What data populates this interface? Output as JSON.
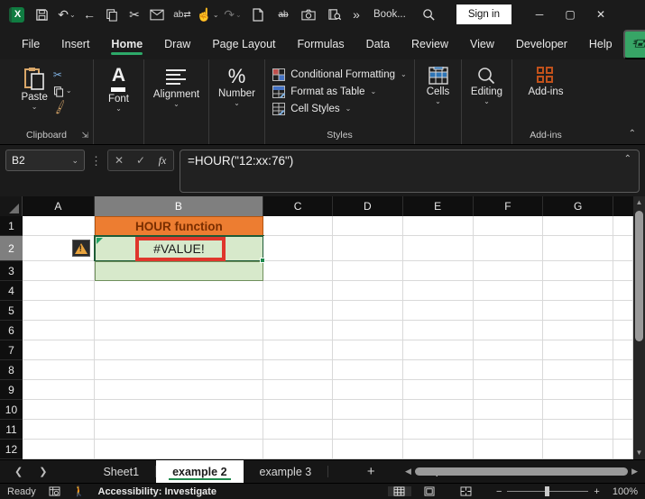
{
  "titlebar": {
    "workbook_name": "Book...",
    "sign_in_label": "Sign in",
    "quick_access_icons": [
      "excel-logo",
      "save",
      "undo",
      "back",
      "copy",
      "cut",
      "email",
      "find-replace",
      "touch-mode",
      "redo",
      "new-file",
      "draw",
      "camera",
      "lookup",
      "more-commands"
    ]
  },
  "menubar": {
    "items": [
      "File",
      "Insert",
      "Home",
      "Draw",
      "Page Layout",
      "Formulas",
      "Data",
      "Review",
      "View",
      "Developer",
      "Help"
    ],
    "active_item": "Home",
    "share_label": "Share"
  },
  "ribbon": {
    "paste_label": "Paste",
    "clipboard_group_label": "Clipboard",
    "font_label": "Font",
    "alignment_label": "Alignment",
    "number_label": "Number",
    "styles_items": [
      "Conditional Formatting",
      "Format as Table",
      "Cell Styles"
    ],
    "styles_group_label": "Styles",
    "cells_label": "Cells",
    "editing_label": "Editing",
    "addins_label": "Add-ins",
    "addins_group_label": "Add-ins"
  },
  "formula_bar": {
    "name_box_value": "B2",
    "formula_value": "=HOUR(\"12:xx:76\")"
  },
  "grid": {
    "columns": [
      "A",
      "B",
      "C",
      "D",
      "E",
      "F",
      "G"
    ],
    "selected_column": "B",
    "rows": [
      "1",
      "2",
      "3",
      "4",
      "5",
      "6",
      "7",
      "8",
      "9",
      "10",
      "11",
      "12"
    ],
    "selected_row": "2",
    "cells": {
      "b1": "HOUR function",
      "b2": "#VALUE!"
    }
  },
  "sheet_tabs": {
    "tabs": [
      "Sheet1",
      "example 2",
      "example 3"
    ],
    "active_tab": "example 2"
  },
  "status_bar": {
    "mode": "Ready",
    "accessibility": "Accessibility: Investigate",
    "zoom_level": "100%"
  },
  "colors": {
    "accent_green": "#21A366",
    "header_orange": "#ED7D31",
    "cell_green": "#D7E9CB",
    "error_annotation_red": "#DF362C",
    "selected_header_gray": "#7F7F7F"
  }
}
